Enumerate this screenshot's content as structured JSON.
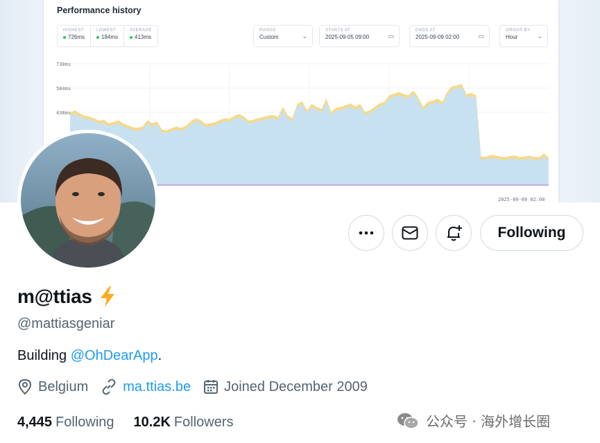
{
  "banner": {
    "title": "Performance history",
    "stats": [
      {
        "label": "HIGHEST",
        "value": "726ms"
      },
      {
        "label": "LOWEST",
        "value": "184ms"
      },
      {
        "label": "AVERAGE",
        "value": "413ms"
      }
    ],
    "controls": {
      "range": {
        "label": "RANGE",
        "value": "Custom"
      },
      "starts": {
        "label": "STARTS AT",
        "value": "2025-09-05 09:00"
      },
      "ends": {
        "label": "ENDS AT",
        "value": "2025-09-09 02:00"
      },
      "group": {
        "label": "GROUP BY",
        "value": "Hour"
      }
    },
    "chart_data": {
      "type": "area",
      "title": "Performance history",
      "y_ticks": [
        "730ms",
        "584ms",
        "438ms"
      ],
      "x_end_label": "2025-09-09 02:00",
      "ylim": [
        0,
        730
      ],
      "series": [
        {
          "color": "#f5d98b",
          "values": [
            438,
            450,
            432,
            418,
            412,
            402,
            388,
            392,
            372,
            380,
            390,
            370,
            360,
            348,
            345,
            352,
            390,
            372,
            382,
            335,
            330,
            342,
            352,
            345,
            358,
            385,
            402,
            392,
            368,
            372,
            378,
            392,
            402,
            398,
            418,
            428,
            412,
            388,
            395,
            404,
            410,
            418,
            422,
            410,
            470,
            420,
            404,
            488,
            505,
            450,
            488,
            470,
            458,
            520,
            440,
            465,
            470,
            480,
            492,
            472,
            488,
            440,
            450,
            470,
            492,
            500,
            540,
            550,
            560,
            548,
            540,
            568,
            532,
            470,
            500,
            508,
            520,
            500,
            560,
            595,
            600,
            610,
            545,
            555,
            540,
            172,
            170,
            182,
            178,
            172,
            168,
            175,
            178,
            168,
            172,
            176,
            170,
            168,
            190,
            165
          ]
        },
        {
          "color": "#c8e1f0",
          "values": [
            420,
            430,
            414,
            400,
            396,
            384,
            370,
            372,
            356,
            362,
            372,
            352,
            344,
            332,
            328,
            334,
            372,
            354,
            364,
            318,
            314,
            324,
            334,
            328,
            340,
            366,
            384,
            374,
            350,
            354,
            360,
            374,
            384,
            380,
            400,
            410,
            394,
            370,
            378,
            386,
            392,
            400,
            404,
            392,
            452,
            402,
            386,
            470,
            488,
            432,
            470,
            452,
            440,
            502,
            422,
            447,
            452,
            462,
            474,
            454,
            470,
            422,
            432,
            452,
            474,
            482,
            522,
            532,
            542,
            530,
            522,
            550,
            514,
            452,
            482,
            490,
            502,
            482,
            542,
            577,
            582,
            592,
            527,
            537,
            522,
            155,
            154,
            165,
            160,
            155,
            150,
            158,
            160,
            150,
            155,
            159,
            153,
            150,
            172,
            148
          ]
        },
        {
          "color": "#d7bfe8",
          "values": [
            0,
            0,
            0,
            0,
            0,
            0,
            0,
            0,
            0,
            0,
            0,
            0,
            0,
            0,
            0,
            0,
            0,
            0,
            0,
            0,
            0,
            0,
            0,
            0,
            0,
            0,
            0,
            0,
            0,
            0,
            0,
            0,
            0,
            0,
            0,
            0,
            0,
            0,
            0,
            0,
            0,
            0,
            0,
            0,
            0,
            0,
            0,
            0,
            0,
            0,
            0,
            0,
            0,
            0,
            0,
            0,
            0,
            0,
            0,
            0,
            0,
            0,
            0,
            0,
            0,
            0,
            0,
            0,
            0,
            0,
            0,
            0,
            0,
            0,
            0,
            0,
            0,
            0,
            0,
            0,
            0,
            0,
            0,
            0,
            0,
            0,
            0,
            0,
            0,
            0,
            0,
            0,
            0,
            0,
            0,
            0,
            0,
            0,
            0,
            0
          ]
        }
      ]
    }
  },
  "actions": {
    "more_icon": "more-horizontal-icon",
    "message_icon": "envelope-icon",
    "notify_icon": "bell-plus-icon",
    "follow_label": "Following"
  },
  "profile": {
    "name": "m@ttias",
    "badge_icon": "lightning-bolt-icon",
    "handle": "@mattiasgeniar",
    "bio_prefix": "Building ",
    "bio_link": "@OhDearApp",
    "bio_suffix": ".",
    "location": "Belgium",
    "website": "ma.ttias.be",
    "joined": "Joined December 2009",
    "following_count": "4,445",
    "following_label": "Following",
    "followers_count": "10.2K",
    "followers_label": "Followers"
  },
  "watermark": {
    "text": "公众号 · 海外增长圈"
  },
  "colors": {
    "link": "#1d9bf0",
    "secondary_text": "#536471",
    "border": "#cfd9de",
    "bolt": "#ffad1f"
  }
}
